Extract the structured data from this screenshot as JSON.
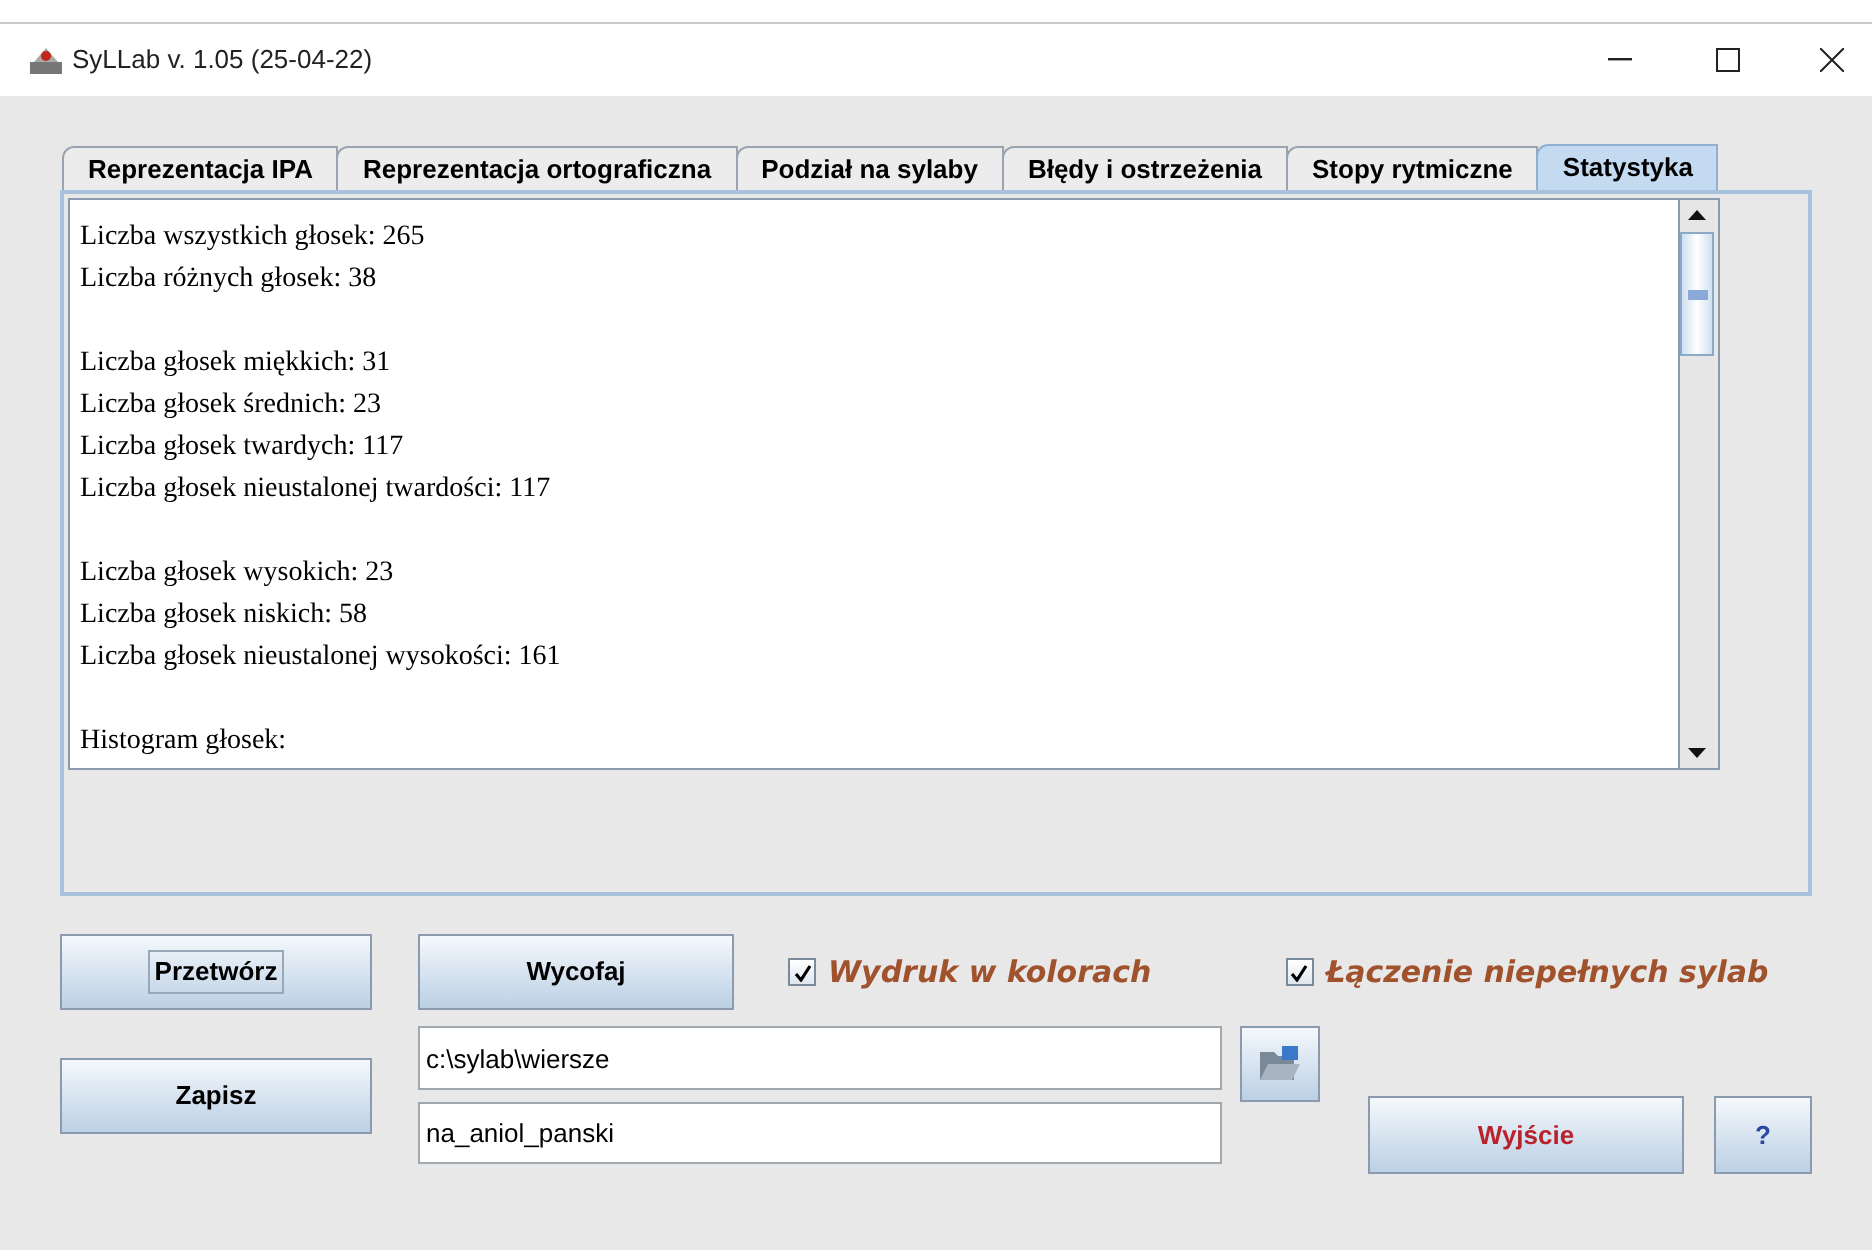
{
  "window": {
    "title": "SyLLab v. 1.05 (25-04-22)"
  },
  "tabs": [
    {
      "label": "Reprezentacja IPA",
      "selected": false
    },
    {
      "label": "Reprezentacja ortograficzna",
      "selected": false
    },
    {
      "label": "Podział na sylaby",
      "selected": false
    },
    {
      "label": "Błędy i ostrzeżenia",
      "selected": false
    },
    {
      "label": "Stopy rytmiczne",
      "selected": false
    },
    {
      "label": "Statystyka",
      "selected": true
    }
  ],
  "statistics": {
    "paragraphs": [
      [
        "Liczba wszystkich głosek: 265",
        "Liczba różnych głosek: 38"
      ],
      [
        "Liczba głosek miękkich: 31",
        "Liczba głosek średnich: 23",
        "Liczba głosek twardych: 117",
        "Liczba głosek nieustalonej twardości: 117"
      ],
      [
        "Liczba głosek wysokich: 23",
        "Liczba głosek niskich: 58",
        "Liczba głosek nieustalonej wysokości: 161"
      ],
      [
        "Histogram głosek:"
      ]
    ]
  },
  "buttons": {
    "process": {
      "label": "Przetwórz",
      "focused": true
    },
    "undo": {
      "label": "Wycofaj",
      "focused": false
    },
    "save": {
      "label": "Zapisz",
      "focused": false
    },
    "exit": {
      "label": "Wyjście"
    },
    "help": {
      "label": "?"
    }
  },
  "options": [
    {
      "label": "Wydruk w kolorach",
      "checked": true
    },
    {
      "label": "Łączenie niepełnych sylab",
      "checked": true
    }
  ],
  "fields": {
    "directory": {
      "value": "c:\\sylab\\wiersze"
    },
    "file_name": {
      "value": "na_aniol_panski"
    }
  }
}
